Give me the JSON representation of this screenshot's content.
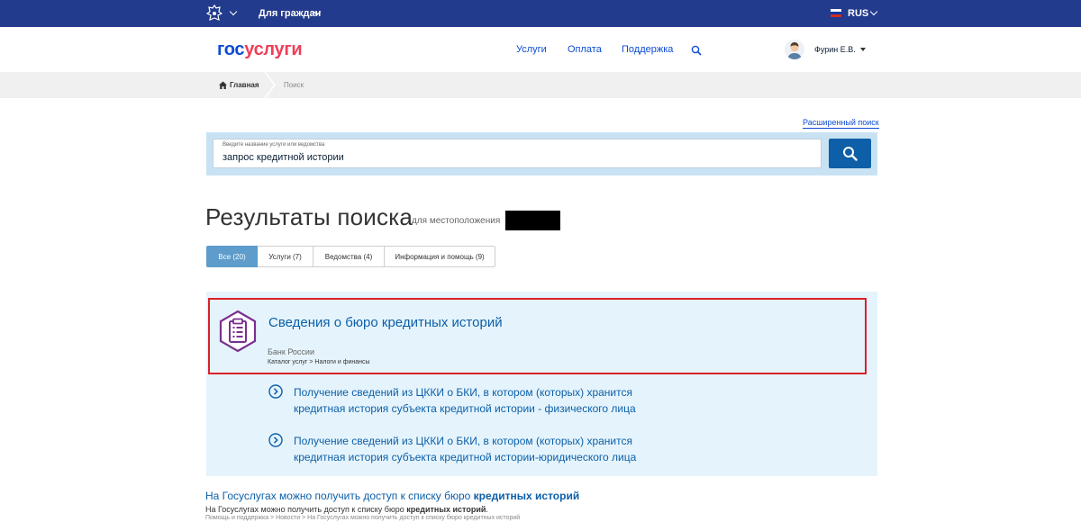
{
  "topbar": {
    "citizens_label": "Для граждан",
    "language": "RUS",
    "emblem_icon": "coat-of-arms-icon",
    "flag_colors": [
      "#ffffff",
      "#0039a6",
      "#d52b1e"
    ]
  },
  "header": {
    "logo_part1": "гос",
    "logo_part2": "услуги",
    "nav": [
      "Услуги",
      "Оплата",
      "Поддержка"
    ],
    "user_name": "Фурин Е.В.",
    "colors": {
      "brand_blue": "#0d4cd3",
      "brand_red": "#ee3f58",
      "topbar": "#233b8c"
    }
  },
  "breadcrumb": {
    "home": "Главная",
    "current": "Поиск"
  },
  "search": {
    "advanced_link": "Расширенный поиск",
    "placeholder": "Введите название услуги или ведомства",
    "value": "запрос кредитной истории"
  },
  "results": {
    "title": "Результаты поиска",
    "location_label": "для местоположения",
    "tabs": [
      {
        "label": "Все (20)",
        "active": true
      },
      {
        "label": "Услуги (7)",
        "active": false
      },
      {
        "label": "Ведомства (4)",
        "active": false
      },
      {
        "label": "Информация и помощь (9)",
        "active": false
      }
    ]
  },
  "card": {
    "title": "Сведения о бюро кредитных историй",
    "org": "Банк России",
    "path": "Каталог услуг > Налоги и финансы",
    "sub_items": [
      "Получение сведений из ЦККИ о БКИ, в котором (которых) хранится кредитная история субъекта кредитной истории - физического лица",
      "Получение сведений из ЦККИ о БКИ, в котором (которых) хранится кредитная история субъекта кредитной истории-юридического лица"
    ]
  },
  "result2": {
    "title_plain": "На Госуслугах можно получить доступ к списку бюро ",
    "title_bold": "кредитных историй",
    "desc_plain": "На Госуслугах можно получить доступ к списку бюро ",
    "desc_bold": "кредитных историй",
    "desc_end": ".",
    "path": "Помощь и поддержка > Новости > На Госуслугах можно получить доступ к списку бюро кредитных историй"
  }
}
